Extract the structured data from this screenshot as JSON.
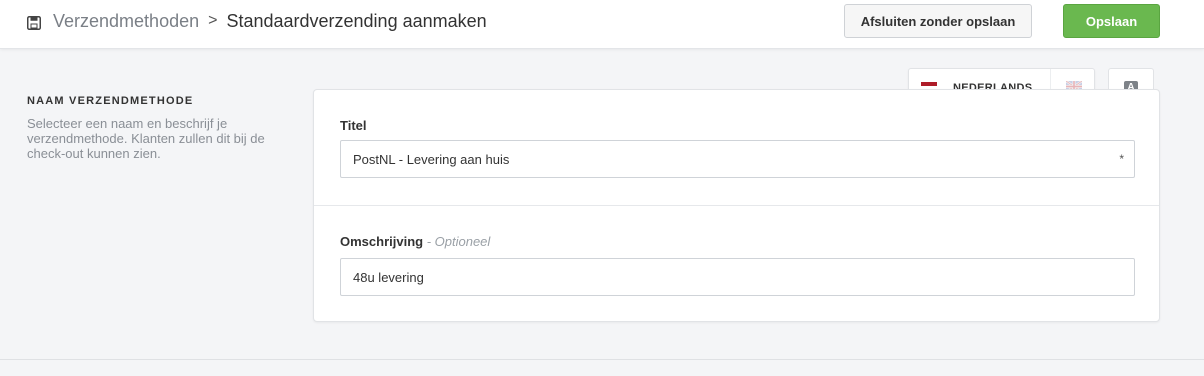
{
  "header": {
    "icon": "save-icon",
    "breadcrumb_parent": "Verzendmethoden",
    "breadcrumb_separator": ">",
    "breadcrumb_current": "Standaardverzending aanmaken",
    "close_without_saving_label": "Afsluiten zonder opslaan",
    "save_label": "Opslaan"
  },
  "section": {
    "title": "NAAM VERZENDMETHODE",
    "description": "Selecteer een naam en beschrijf je verzendmethode. Klanten zullen dit bij de check-out kunnen zien."
  },
  "language_switcher": {
    "active_language": "NEDERLANDS",
    "active_flag_icon": "flag-nl-icon",
    "other_flag_icon": "flag-gb-icon",
    "auto_translate_letter": "A"
  },
  "form": {
    "title_label": "Titel",
    "title_value": "PostNL - Levering aan huis",
    "title_required_marker": "*",
    "description_label": "Omschrijving",
    "description_optional": "- Optioneel",
    "description_value": "48u levering"
  },
  "colors": {
    "primary_button": "#6ab84f",
    "background": "#f4f5f7"
  }
}
